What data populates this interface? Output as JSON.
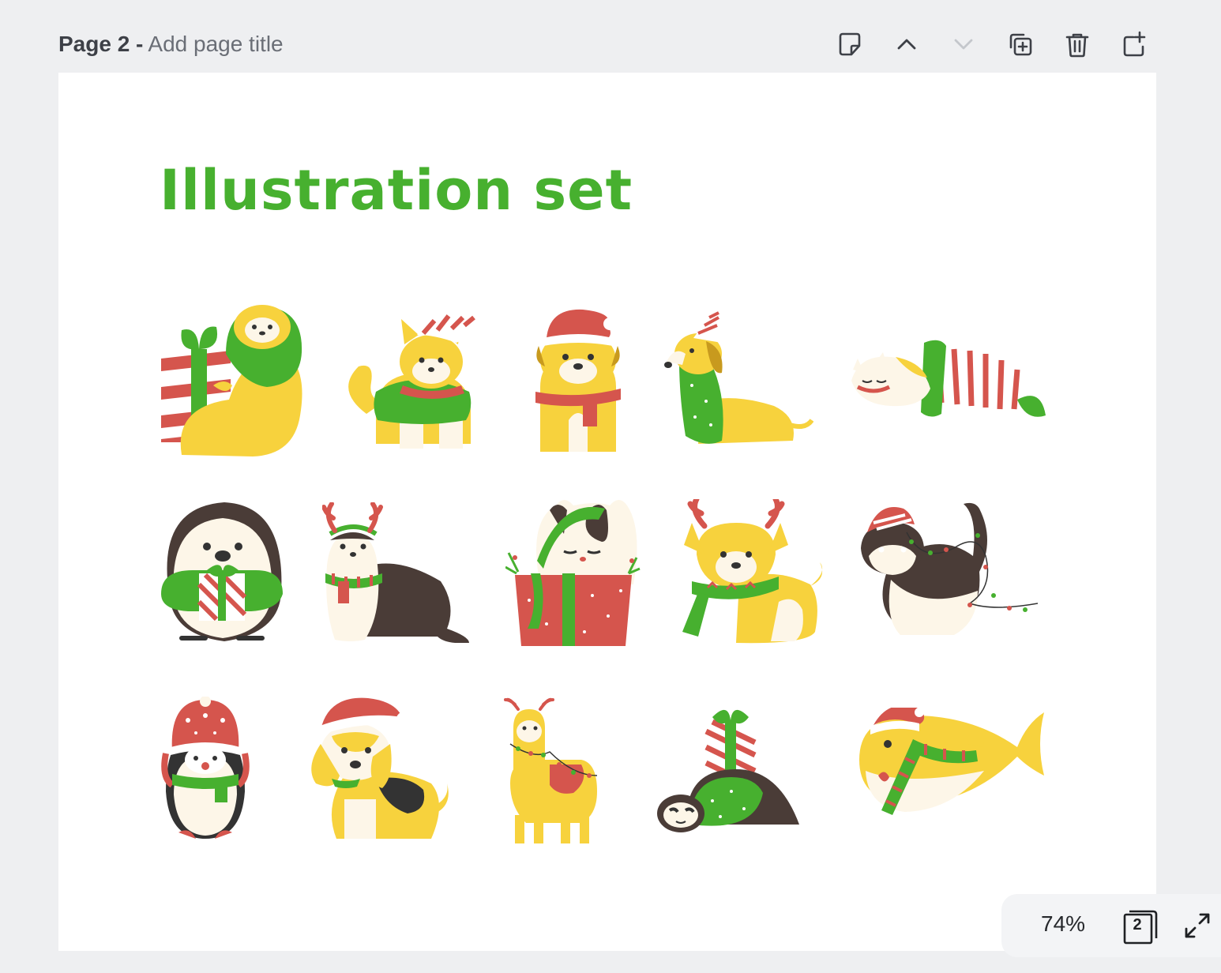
{
  "header": {
    "page_number": "Page 2 -",
    "page_title_placeholder": "Add page title"
  },
  "toolbar": {
    "icons": [
      "sticky-note-icon",
      "chevron-up-icon",
      "chevron-down-icon",
      "duplicate-page-icon",
      "trash-icon",
      "add-page-icon"
    ]
  },
  "canvas": {
    "heading": "Illustration set",
    "illustrations": [
      "sloth-with-gift",
      "shiba-dog-in-sweater",
      "pug-in-santa-hat",
      "dachshund-in-party-hat",
      "cat-in-stocking",
      "hedgehog-with-gift",
      "ferret-with-antlers",
      "cat-in-gift-box",
      "corgi-with-antlers",
      "cat-with-lights",
      "penguin-in-knit-hat",
      "beagle-in-santa-hat",
      "llama-with-lights",
      "sloth-under-gift",
      "shark-in-santa-hat"
    ]
  },
  "footer": {
    "zoom": "74%",
    "page_count": "2"
  },
  "colors": {
    "green": "#47b02f",
    "yellow": "#f7d23d",
    "red": "#d5554d",
    "cream": "#fdf6e8",
    "brown": "#4a3c37"
  }
}
